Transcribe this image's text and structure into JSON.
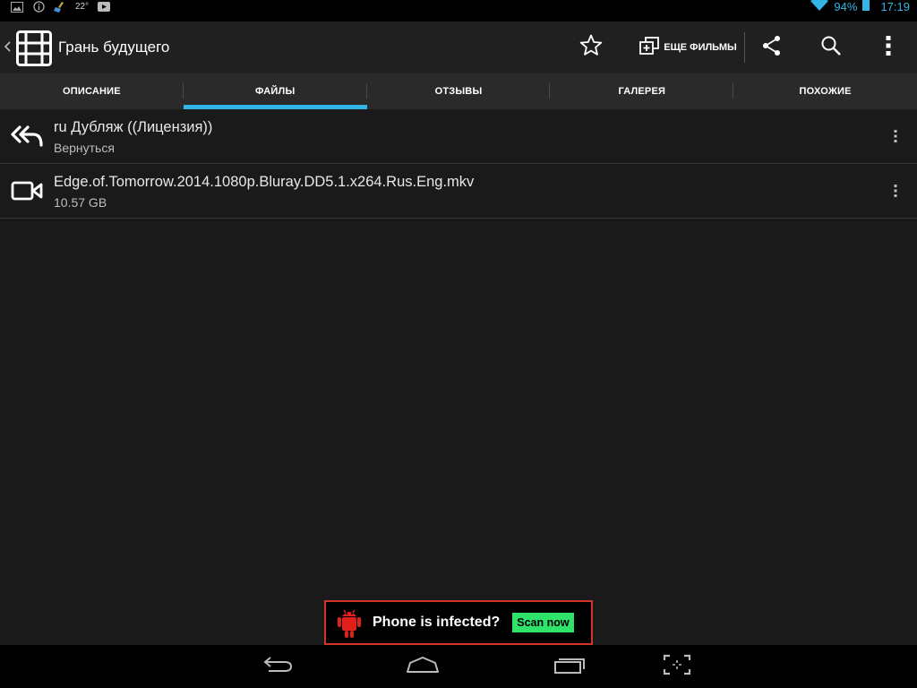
{
  "status_bar": {
    "temperature": "22°",
    "battery_percent": "94%",
    "battery_level": 0.94,
    "clock": "17:19",
    "left_icons": [
      "image-icon",
      "info-icon",
      "cleaner-icon",
      "youtube-icon"
    ],
    "right_icons": [
      "wifi-icon",
      "battery-icon"
    ]
  },
  "action_bar": {
    "title": "Грань будущего",
    "more_films_label": "ЕЩЕ ФИЛЬМЫ",
    "icons": [
      "film-icon",
      "star-icon",
      "add-library-icon",
      "share-icon",
      "search-icon",
      "overflow-menu-icon"
    ]
  },
  "tabs": [
    {
      "label": "ОПИСАНИЕ",
      "active": false
    },
    {
      "label": "ФАЙЛЫ",
      "active": true
    },
    {
      "label": "ОТЗЫВЫ",
      "active": false
    },
    {
      "label": "ГАЛЕРЕЯ",
      "active": false
    },
    {
      "label": "ПОХОЖИЕ",
      "active": false
    }
  ],
  "files": [
    {
      "title": "ru Дубляж ((Лицензия))",
      "subtitle": "Вернуться",
      "icon": "reply-all-icon"
    },
    {
      "title": "Edge.of.Tomorrow.2014.1080p.Bluray.DD5.1.x264.Rus.Eng.mkv",
      "subtitle": "10.57 GB",
      "icon": "video-camera-icon"
    }
  ],
  "ad": {
    "text": "Phone is infected?",
    "button_label": "Scan now",
    "icon": "android-robot-icon"
  },
  "nav_bar": {
    "icons": [
      "back-icon",
      "home-icon",
      "recent-apps-icon",
      "screenshot-icon"
    ]
  },
  "colors": {
    "accent": "#33b5e5",
    "action_bar_bg": "#202020",
    "tabs_bg": "#2a2a2a",
    "content_bg": "#1a1a1a",
    "ad_border": "#d0342c",
    "ad_button": "#2ee26a",
    "ad_robot": "#e0201b"
  }
}
